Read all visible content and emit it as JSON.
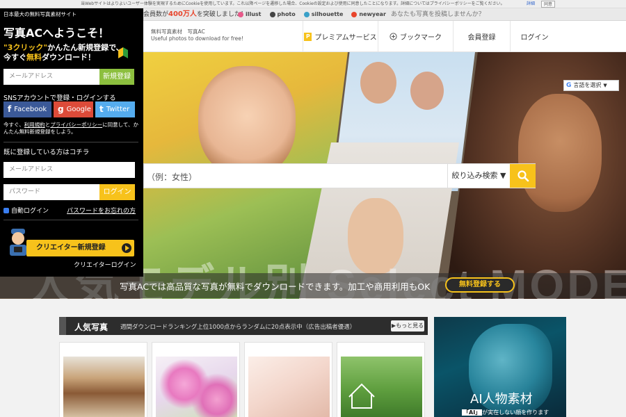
{
  "cookie": {
    "text": "当Webサイトはよりよいユーザー体験を実現するためにCookieを使用しています。これ以降ページを遷移した場合、Cookieの設定および使用に同意したことになります。詳細についてはプライバシーポリシーをご覧ください。",
    "detail_label": "詳細",
    "agree_label": "同意"
  },
  "topstrip": {
    "members_prefix": "会員数が",
    "members_count": "400万人",
    "members_suffix": "を突破しました！",
    "sites": [
      {
        "label": "illust",
        "color": "#e85a8a"
      },
      {
        "label": "photo",
        "color": "#444444"
      },
      {
        "label": "silhouette",
        "color": "#3aa0c8"
      },
      {
        "label": "newyear",
        "color": "#e8452c"
      }
    ],
    "post_text": "あなたも写真を投稿しませんか？"
  },
  "header": {
    "logo_line1": "無料写真素材　写真AC",
    "logo_line2": "Useful photos to download for free!",
    "nav": [
      {
        "label": "プレミアムサービス",
        "icon": "premium-p-icon"
      },
      {
        "label": "ブックマーク",
        "icon": "plus-circle-icon"
      },
      {
        "label": "会員登録",
        "icon": ""
      },
      {
        "label": "ログイン",
        "icon": ""
      }
    ]
  },
  "hero": {
    "big_text": "人気モデル別 Select MODEL LIST",
    "caption": "写真ACでは高品質な写真が無料でダウンロードできます。加工や商用利用もOK",
    "free_register_label": "無料登録する",
    "language_label": "言語を選択",
    "search": {
      "placeholder": "（例：女性）",
      "filter_label": "絞り込み検索 ▼"
    }
  },
  "panel": {
    "site_tag": "日本最大の無料写真素材サイト",
    "welcome_brand": "写真AC",
    "welcome_rest": "へようこそ！",
    "promo_q1": "\"3クリック\"",
    "promo_rest1": "かんたん新規登録で、",
    "promo_pre2": "今すぐ",
    "promo_free": "無料",
    "promo_rest2": "ダウンロード！",
    "email_placeholder": "メールアドレス",
    "register_label": "新規登録",
    "sns_label": "SNSアカウントで登録・ログインする",
    "sns": [
      {
        "label": "Facebook",
        "icon": "f",
        "color": "#3b5998"
      },
      {
        "label": "Google",
        "icon": "g",
        "color": "#dd4b39"
      },
      {
        "label": "Twitter",
        "icon": "t",
        "color": "#55acee"
      }
    ],
    "terms_pre": "今すぐ、",
    "terms_link1": "利用規約",
    "terms_mid": "と",
    "terms_link2": "プライバシーポリシー",
    "terms_post": "に同意して、かんたん無料新規登録をしよう。",
    "already_label": "既に登録している方はコチラ",
    "login_email_placeholder": "メールアドレス",
    "password_placeholder": "パスワード",
    "login_label": "ログイン",
    "auto_login_label": "自動ログイン",
    "forgot_label": "パスワードをお忘れの方",
    "creator_register_label": "クリエイター新規登録",
    "creator_login_label": "クリエイターログイン"
  },
  "popular": {
    "title": "人気写真",
    "subtitle": "週間ダウンロードランキング上位1000点からランダムに20点表示中（広告出稿者優遇）",
    "more_label": "▶もっと見る",
    "cards": [
      {
        "name": "books-photo"
      },
      {
        "name": "cosmos-flowers-photo"
      },
      {
        "name": "skin-closeup-photo"
      },
      {
        "name": "house-on-grass-photo"
      }
    ]
  },
  "ad": {
    "title": "AI人物素材",
    "subtitle_tag": "「AI」",
    "subtitle_rest": "が実在しない顔を作ります"
  },
  "colors": {
    "accent": "#f7c21b",
    "green": "#8cbf3e",
    "panel_bg": "#000000"
  }
}
